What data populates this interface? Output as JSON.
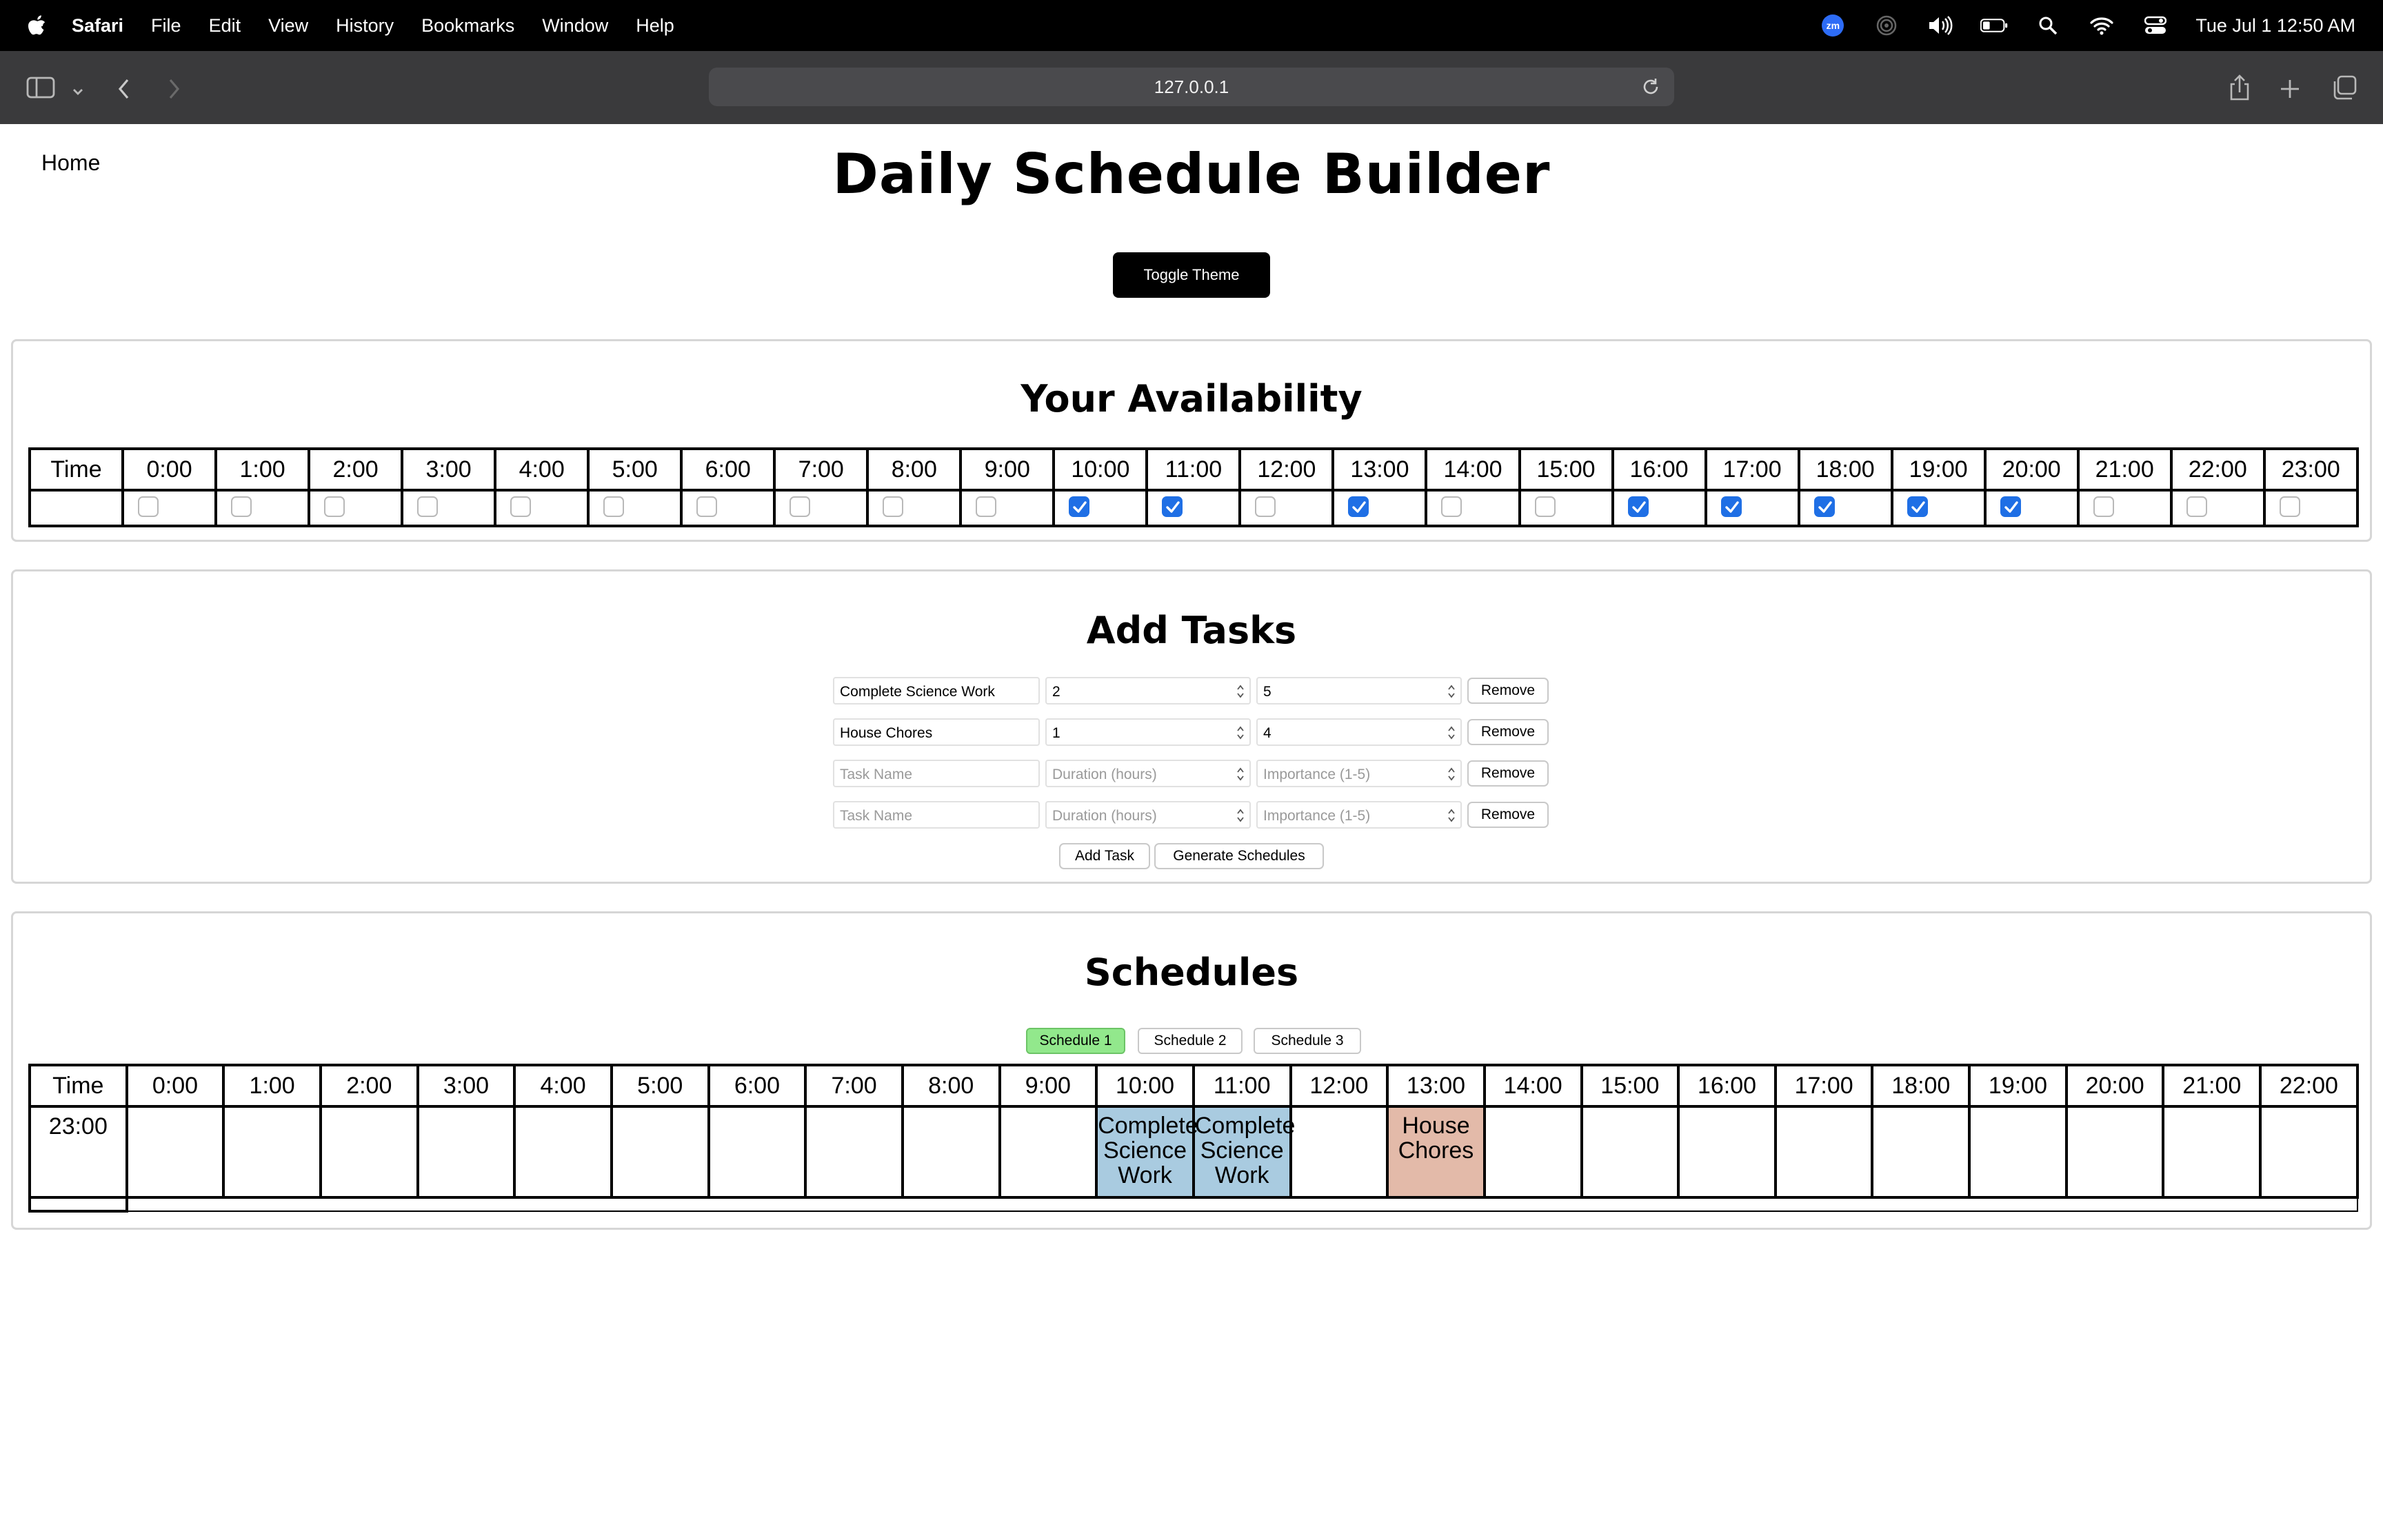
{
  "menubar": {
    "app_name": "Safari",
    "items": [
      "File",
      "Edit",
      "View",
      "History",
      "Bookmarks",
      "Window",
      "Help"
    ],
    "status_icons": [
      "zoom-icon",
      "airdrop-icon",
      "volume-icon",
      "battery-icon",
      "spotlight-icon",
      "wifi-icon",
      "control-center-icon"
    ],
    "zoom_badge": "zm",
    "clock": "Tue Jul 1  12:50 AM"
  },
  "browser": {
    "url": "127.0.0.1"
  },
  "page": {
    "home_link": "Home",
    "title": "Daily Schedule Builder",
    "toggle_theme": "Toggle Theme"
  },
  "availability": {
    "title": "Your Availability",
    "time_header": "Time",
    "hours": [
      "0:00",
      "1:00",
      "2:00",
      "3:00",
      "4:00",
      "5:00",
      "6:00",
      "7:00",
      "8:00",
      "9:00",
      "10:00",
      "11:00",
      "12:00",
      "13:00",
      "14:00",
      "15:00",
      "16:00",
      "17:00",
      "18:00",
      "19:00",
      "20:00",
      "21:00",
      "22:00",
      "23:00"
    ],
    "checked": [
      false,
      false,
      false,
      false,
      false,
      false,
      false,
      false,
      false,
      false,
      true,
      true,
      false,
      true,
      false,
      false,
      true,
      true,
      true,
      true,
      true,
      false,
      false,
      false
    ]
  },
  "tasks": {
    "title": "Add Tasks",
    "placeholders": {
      "name": "Task Name",
      "duration": "Duration (hours)",
      "importance": "Importance (1-5)"
    },
    "rows": [
      {
        "name": "Complete Science Work",
        "duration": "2",
        "importance": "5"
      },
      {
        "name": "House Chores",
        "duration": "1",
        "importance": "4"
      },
      {
        "name": "",
        "duration": "",
        "importance": ""
      },
      {
        "name": "",
        "duration": "",
        "importance": ""
      }
    ],
    "remove_label": "Remove",
    "add_task_label": "Add Task",
    "generate_label": "Generate Schedules"
  },
  "schedules": {
    "title": "Schedules",
    "tabs": [
      "Schedule 1",
      "Schedule 2",
      "Schedule 3"
    ],
    "active_tab": "Schedule 1",
    "time_header": "Time",
    "hours": [
      "0:00",
      "1:00",
      "2:00",
      "3:00",
      "4:00",
      "5:00",
      "6:00",
      "7:00",
      "8:00",
      "9:00",
      "10:00",
      "11:00",
      "12:00",
      "13:00",
      "14:00",
      "15:00",
      "16:00",
      "17:00",
      "18:00",
      "19:00",
      "20:00",
      "21:00",
      "22:00"
    ],
    "row_time": "23:00",
    "slots": [
      "",
      "",
      "",
      "",
      "",
      "",
      "",
      "",
      "",
      "",
      "Complete Science Work",
      "Complete Science Work",
      "",
      "House Chores",
      "",
      "",
      "",
      "",
      "",
      "",
      "",
      "",
      ""
    ],
    "slot_colors": {
      "Complete Science Work": "#a9cbe0",
      "House Chores": "#e3baa9"
    }
  },
  "colors": {
    "checkbox_checked": "#1f6fe5",
    "active_tab": "#92e88c"
  }
}
